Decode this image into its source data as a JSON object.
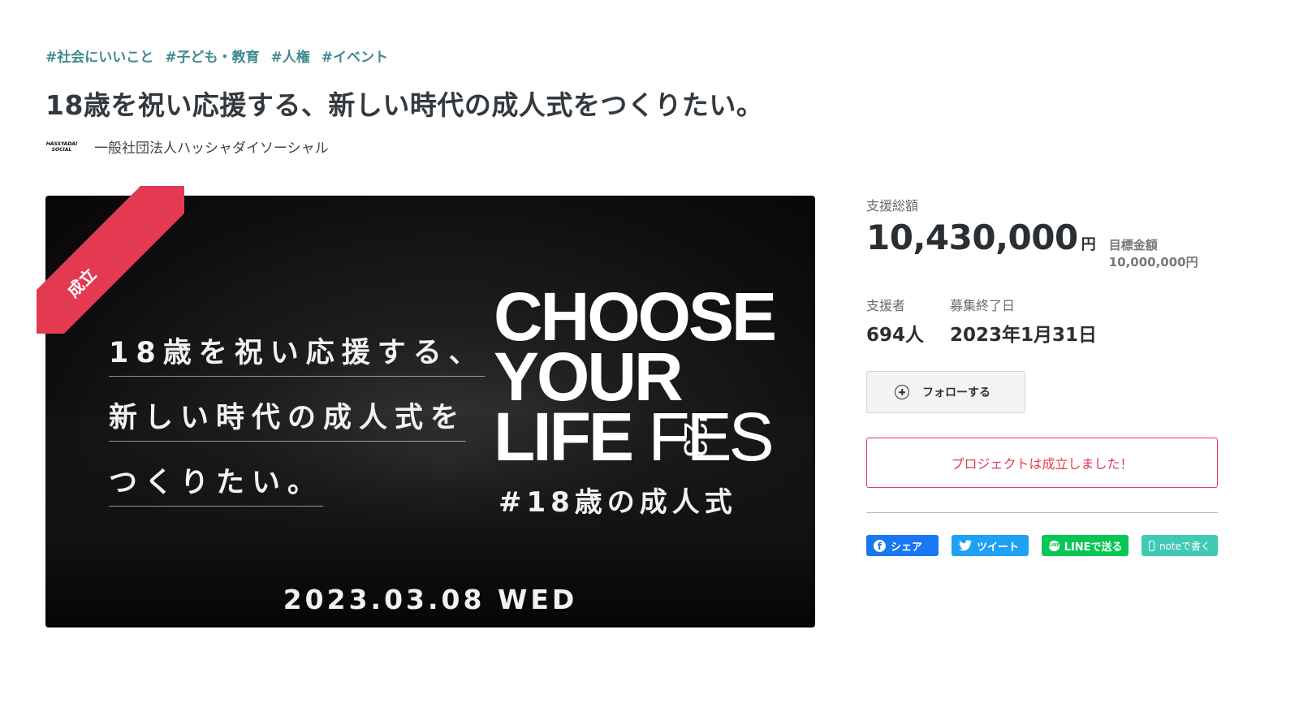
{
  "tags": [
    "#社会にいいこと",
    "#子ども・教育",
    "#人権",
    "#イベント"
  ],
  "project_title": "18歳を祝い応援する、新しい時代の成人式をつくりたい。",
  "owner": {
    "logo_line1": "HASSYADAI",
    "logo_line2": "SOCIAL",
    "name": "一般社団法人ハッシャダイソーシャル"
  },
  "hero": {
    "ribbon_label": "成立",
    "lines": [
      "18歳を祝い応援する、",
      "新しい時代の成人式を",
      "つくりたい。"
    ],
    "logo_row1": "CHOOSE",
    "logo_row2": "YOUR",
    "logo_row3_a": "LIFE",
    "logo_row3_b": "FES",
    "logo_year": "'23",
    "hashtag": "#18歳の成人式",
    "date": "2023.03.08 WED"
  },
  "funding": {
    "total_label": "支援総額",
    "total_amount": "10,430,000",
    "currency": "円",
    "goal": "目標金額 10,000,000円",
    "backers_label": "支援者",
    "backers_value": "694人",
    "end_label": "募集終了日",
    "end_value": "2023年1月31日"
  },
  "follow_label": "フォローする",
  "status_text": "プロジェクトは成立しました！",
  "share": {
    "facebook": "シェア",
    "twitter": "ツイート",
    "line": "LINEで送る",
    "line_icon_text": "LINE",
    "note": "noteで書く"
  },
  "colors": {
    "tag": "#3f8a8f",
    "accent_red": "#e43a51",
    "facebook": "#1877f2",
    "twitter": "#1da1f2",
    "line": "#06c755",
    "note": "#41c9b4"
  },
  "icons": [
    "plus-circle-icon",
    "facebook-icon",
    "twitter-icon",
    "line-icon",
    "note-icon"
  ]
}
